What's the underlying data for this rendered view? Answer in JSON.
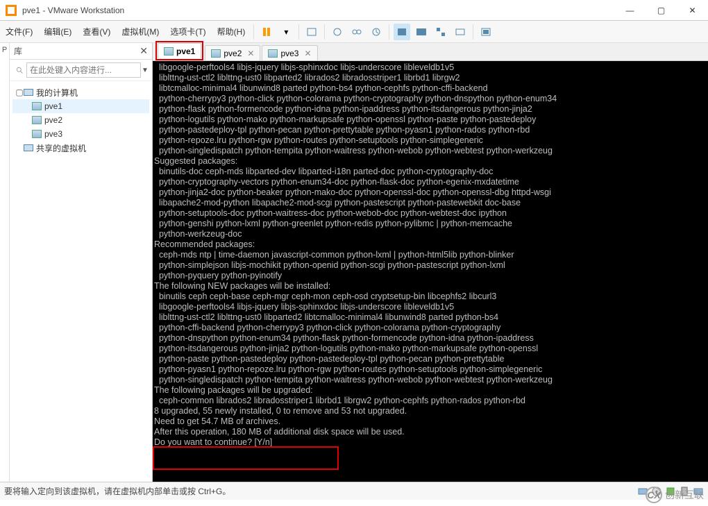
{
  "window": {
    "title": "pve1 - VMware Workstation"
  },
  "menu": {
    "items": [
      "文件(F)",
      "编辑(E)",
      "查看(V)",
      "虚拟机(M)",
      "选项卡(T)",
      "帮助(H)"
    ]
  },
  "sidebar": {
    "header_label": "库",
    "search_placeholder": "在此处键入内容进行...",
    "root": "我的计算机",
    "children": [
      "pve1",
      "pve2",
      "pve3"
    ],
    "shared": "共享的虚拟机"
  },
  "tabs": [
    {
      "label": "pve1",
      "active": true,
      "highlighted": true
    },
    {
      "label": "pve2",
      "active": false
    },
    {
      "label": "pve3",
      "active": false
    }
  ],
  "terminal_lines": [
    "  libgoogle-perftools4 libjs-jquery libjs-sphinxdoc libjs-underscore libleveldb1v5",
    "  liblttng-ust-ctl2 liblttng-ust0 libparted2 librados2 libradosstriper1 librbd1 librgw2",
    "  libtcmalloc-minimal4 libunwind8 parted python-bs4 python-cephfs python-cffi-backend",
    "  python-cherrypy3 python-click python-colorama python-cryptography python-dnspython python-enum34",
    "  python-flask python-formencode python-idna python-ipaddress python-itsdangerous python-jinja2",
    "  python-logutils python-mako python-markupsafe python-openssl python-paste python-pastedeploy",
    "  python-pastedeploy-tpl python-pecan python-prettytable python-pyasn1 python-rados python-rbd",
    "  python-repoze.lru python-rgw python-routes python-setuptools python-simplegeneric",
    "  python-singledispatch python-tempita python-waitress python-webob python-webtest python-werkzeug",
    "Suggested packages:",
    "  binutils-doc ceph-mds libparted-dev libparted-i18n parted-doc python-cryptography-doc",
    "  python-cryptography-vectors python-enum34-doc python-flask-doc python-egenix-mxdatetime",
    "  python-jinja2-doc python-beaker python-mako-doc python-openssl-doc python-openssl-dbg httpd-wsgi",
    "  libapache2-mod-python libapache2-mod-scgi python-pastescript python-pastewebkit doc-base",
    "  python-setuptools-doc python-waitress-doc python-webob-doc python-webtest-doc ipython",
    "  python-genshi python-lxml python-greenlet python-redis python-pylibmc | python-memcache",
    "  python-werkzeug-doc",
    "Recommended packages:",
    "  ceph-mds ntp | time-daemon javascript-common python-lxml | python-html5lib python-blinker",
    "  python-simplejson libjs-mochikit python-openid python-scgi python-pastescript python-lxml",
    "  python-pyquery python-pyinotify",
    "The following NEW packages will be installed:",
    "  binutils ceph ceph-base ceph-mgr ceph-mon ceph-osd cryptsetup-bin libcephfs2 libcurl3",
    "  libgoogle-perftools4 libjs-jquery libjs-sphinxdoc libjs-underscore libleveldb1v5",
    "  liblttng-ust-ctl2 liblttng-ust0 libparted2 libtcmalloc-minimal4 libunwind8 parted python-bs4",
    "  python-cffi-backend python-cherrypy3 python-click python-colorama python-cryptography",
    "  python-dnspython python-enum34 python-flask python-formencode python-idna python-ipaddress",
    "  python-itsdangerous python-jinja2 python-logutils python-mako python-markupsafe python-openssl",
    "  python-paste python-pastedeploy python-pastedeploy-tpl python-pecan python-prettytable",
    "  python-pyasn1 python-repoze.lru python-rgw python-routes python-setuptools python-simplegeneric",
    "  python-singledispatch python-tempita python-waitress python-webob python-webtest python-werkzeug",
    "The following packages will be upgraded:",
    "  ceph-common librados2 libradosstriper1 librbd1 librgw2 python-cephfs python-rados python-rbd",
    "8 upgraded, 55 newly installed, 0 to remove and 53 not upgraded.",
    "Need to get 54.7 MB of archives.",
    "After this operation, 180 MB of additional disk space will be used.",
    "Do you want to continue? [Y/n]"
  ],
  "statusbar": {
    "text": "要将输入定向到该虚拟机，请在虚拟机内部单击或按 Ctrl+G。"
  },
  "watermark": {
    "text": "创新互联"
  }
}
